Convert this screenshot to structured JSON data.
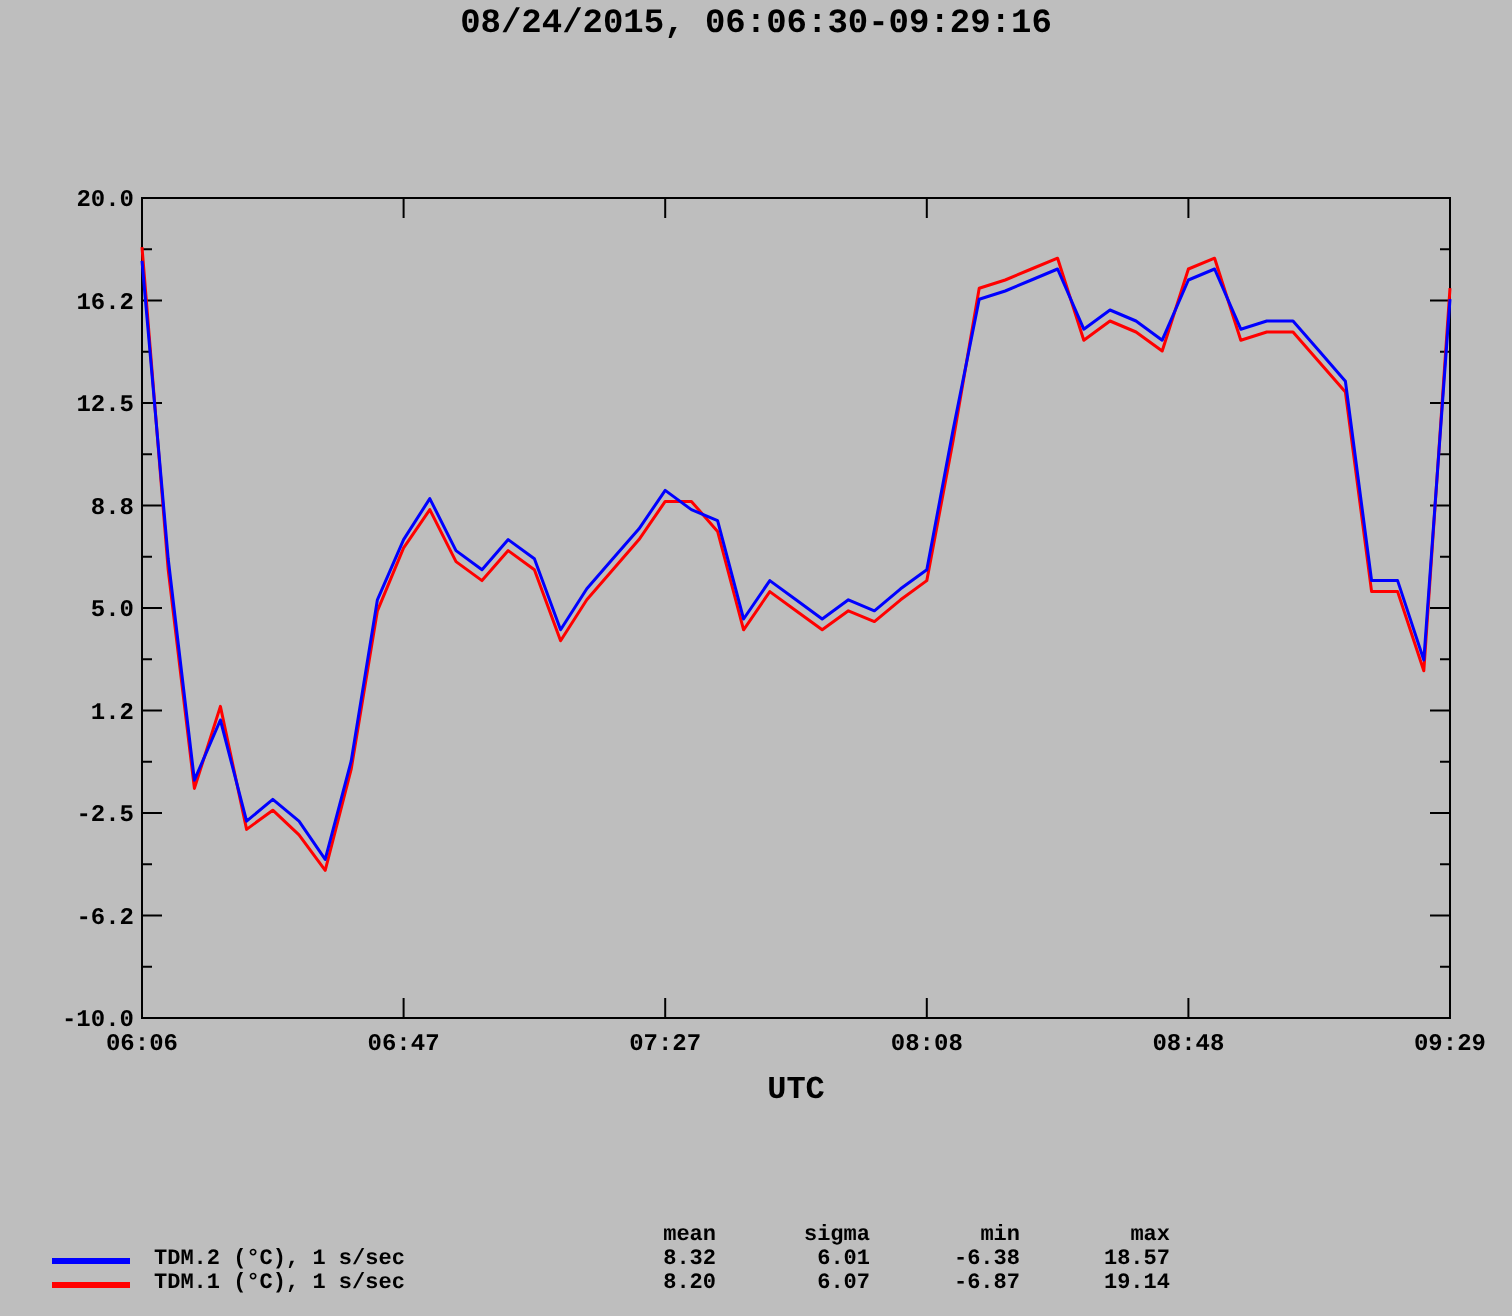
{
  "title": "08/24/2015, 06:06:30-09:29:16",
  "chart_data": {
    "type": "line",
    "xlabel": "UTC",
    "categories": [
      "06:06",
      null,
      null,
      null,
      null,
      null,
      null,
      null,
      null,
      null,
      "06:47",
      null,
      null,
      null,
      null,
      null,
      null,
      null,
      null,
      null,
      "07:27",
      null,
      null,
      null,
      null,
      null,
      null,
      null,
      null,
      null,
      "08:08",
      null,
      null,
      null,
      null,
      null,
      null,
      null,
      null,
      null,
      "08:48",
      null,
      null,
      null,
      null,
      null,
      null,
      null,
      null,
      null,
      "09:29"
    ],
    "series": [
      {
        "name": "TDM.2 (°C), 1 s/sec",
        "color": "#0000ff",
        "values": [
          17.7,
          6.8,
          -1.3,
          0.9,
          -2.8,
          -2,
          -2.8,
          -4.2,
          -0.6,
          5.3,
          7.5,
          9,
          7.1,
          6.4,
          7.5,
          6.8,
          4.2,
          5.7,
          6.8,
          7.9,
          9.3,
          8.6,
          8.2,
          4.6,
          6,
          5.3,
          4.6,
          5.3,
          4.9,
          5.7,
          6.4,
          11.5,
          16.3,
          16.6,
          17,
          17.4,
          15.2,
          15.9,
          15.5,
          14.8,
          17,
          17.4,
          15.2,
          15.5,
          15.5,
          14.4,
          13.3,
          6,
          6,
          3.1,
          16.3
        ]
      },
      {
        "name": "TDM.1 (°C), 1 s/sec",
        "color": "#ff0000",
        "values": [
          18.2,
          6.4,
          -1.6,
          1.4,
          -3.1,
          -2.4,
          -3.3,
          -4.6,
          -0.9,
          4.9,
          7.2,
          8.6,
          6.7,
          6.0,
          7.1,
          6.4,
          3.8,
          5.3,
          6.4,
          7.5,
          8.9,
          8.9,
          7.8,
          4.2,
          5.6,
          4.9,
          4.2,
          4.9,
          4.5,
          5.3,
          6.0,
          11.1,
          16.7,
          17.0,
          17.4,
          17.8,
          14.8,
          15.5,
          15.1,
          14.4,
          17.4,
          17.8,
          14.8,
          15.1,
          15.1,
          14.0,
          12.9,
          5.6,
          5.6,
          2.7,
          16.7
        ]
      }
    ],
    "ylim": [
      -10,
      20
    ],
    "yticks": [
      {
        "value": -10,
        "label": "-10.0"
      },
      {
        "value": -6.25,
        "label": "-6.2"
      },
      {
        "value": -2.5,
        "label": "-2.5"
      },
      {
        "value": 1.25,
        "label": "1.2"
      },
      {
        "value": 5,
        "label": "5.0"
      },
      {
        "value": 8.75,
        "label": "8.8"
      },
      {
        "value": 12.5,
        "label": "12.5"
      },
      {
        "value": 16.25,
        "label": "16.2"
      },
      {
        "value": 20,
        "label": "20.0"
      }
    ]
  },
  "legend": {
    "columns": [
      "mean",
      "sigma",
      "min",
      "max"
    ],
    "rows": [
      {
        "values": [
          "8.32",
          "6.01",
          "-6.38",
          "18.57"
        ]
      },
      {
        "values": [
          "8.20",
          "6.07",
          "-6.87",
          "19.14"
        ]
      }
    ]
  }
}
